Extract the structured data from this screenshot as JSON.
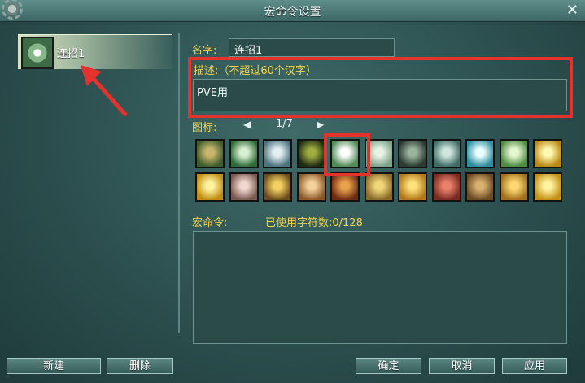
{
  "window": {
    "title": "宏命令设置"
  },
  "sidebar": {
    "items": [
      {
        "label": "连招1"
      }
    ]
  },
  "form": {
    "name_label": "名字:",
    "name_value": "连招1",
    "desc_label": "描述:（不超过60个汉字）",
    "desc_value": "PVE用",
    "icon_label": "图标:",
    "icon_page": "1/7",
    "macro_label": "宏命令:",
    "char_count": "已使用字符数:0/128",
    "macro_value": ""
  },
  "icons": [
    {
      "name": "bamboo-figure-icon",
      "c1": "#c9b66e",
      "c2": "#3f5d2c"
    },
    {
      "name": "green-drop-icon",
      "c1": "#d9f0d0",
      "c2": "#2f6b3a"
    },
    {
      "name": "swirl-wind-icon",
      "c1": "#e3eef2",
      "c2": "#4d7380"
    },
    {
      "name": "dancer-silhouette-icon",
      "c1": "#9fae40",
      "c2": "#1f2a14"
    },
    {
      "name": "white-flower-icon",
      "c1": "#ffffff",
      "c2": "#4f8a57"
    },
    {
      "name": "moon-orb-icon",
      "c1": "#e8f3e6",
      "c2": "#7ba38a"
    },
    {
      "name": "mask-face-icon",
      "c1": "#9bb29e",
      "c2": "#2c3c32"
    },
    {
      "name": "ring-sigil-icon",
      "c1": "#cfe6de",
      "c2": "#3f6d66"
    },
    {
      "name": "cyan-burst-icon",
      "c1": "#e9ffff",
      "c2": "#2c8ea3"
    },
    {
      "name": "green-crystal-icon",
      "c1": "#e5f7cf",
      "c2": "#4f8b43"
    },
    {
      "name": "gold-flash-icon",
      "c1": "#fff7b0",
      "c2": "#b88a12"
    },
    {
      "name": "gold-rays-icon",
      "c1": "#fff3a0",
      "c2": "#c08d10"
    },
    {
      "name": "broken-heart-icon",
      "c1": "#f0d6cf",
      "c2": "#7a5a50"
    },
    {
      "name": "wooden-staff-icon",
      "c1": "#f3d060",
      "c2": "#6b4b1a"
    },
    {
      "name": "buddha-face-icon",
      "c1": "#f4d09a",
      "c2": "#8b5a2b"
    },
    {
      "name": "monk-flame-icon",
      "c1": "#e8a24a",
      "c2": "#6e2a12"
    },
    {
      "name": "golden-wheel-icon",
      "c1": "#f2d77a",
      "c2": "#8a6a2a"
    },
    {
      "name": "golden-palm-icon",
      "c1": "#ffe07a",
      "c2": "#b3781a"
    },
    {
      "name": "red-rune-icon",
      "c1": "#e8806a",
      "c2": "#7a2a20"
    },
    {
      "name": "twin-statue-icon",
      "c1": "#d8b070",
      "c2": "#6a4a22"
    },
    {
      "name": "seated-buddha-icon",
      "c1": "#ffd772",
      "c2": "#a0701c"
    },
    {
      "name": "gold-slash-icon",
      "c1": "#fff2a0",
      "c2": "#c29014"
    }
  ],
  "buttons": {
    "new": "新建",
    "delete": "删除",
    "confirm": "确定",
    "cancel": "取消",
    "apply": "应用"
  },
  "symbols": {
    "close": "✕",
    "prev": "◀",
    "next": "▶"
  },
  "colors": {
    "label_yellow": "#f4d44a",
    "highlight_red": "#e5322d"
  }
}
